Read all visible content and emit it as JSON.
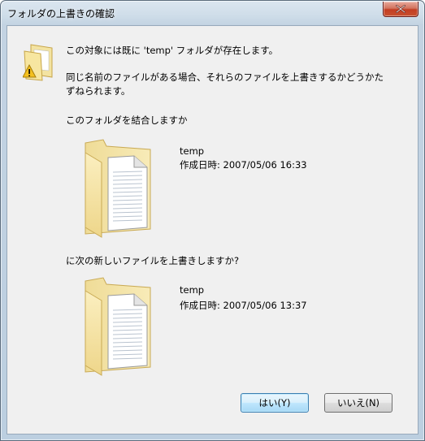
{
  "window": {
    "title": "フォルダの上書きの確認"
  },
  "message": {
    "line1": "この対象には既に 'temp' フォルダが存在します。",
    "line2": "同じ名前のファイルがある場合、それらのファイルを上書きするかどうかた",
    "line3": "ずねられます。",
    "merge_question": "このフォルダを結合しますか",
    "replace_question": "に次の新しいファイルを上書きしますか?"
  },
  "existing_folder": {
    "name": "temp",
    "created": "作成日時: 2007/05/06 16:33"
  },
  "new_folder": {
    "name": "temp",
    "created": "作成日時: 2007/05/06 13:37"
  },
  "buttons": {
    "yes": "はい(Y)",
    "no": "いいえ(N)"
  },
  "icons": {
    "title_close": "close-icon",
    "warning": "folder-warning-icon",
    "folder": "folder-with-document-icon"
  }
}
